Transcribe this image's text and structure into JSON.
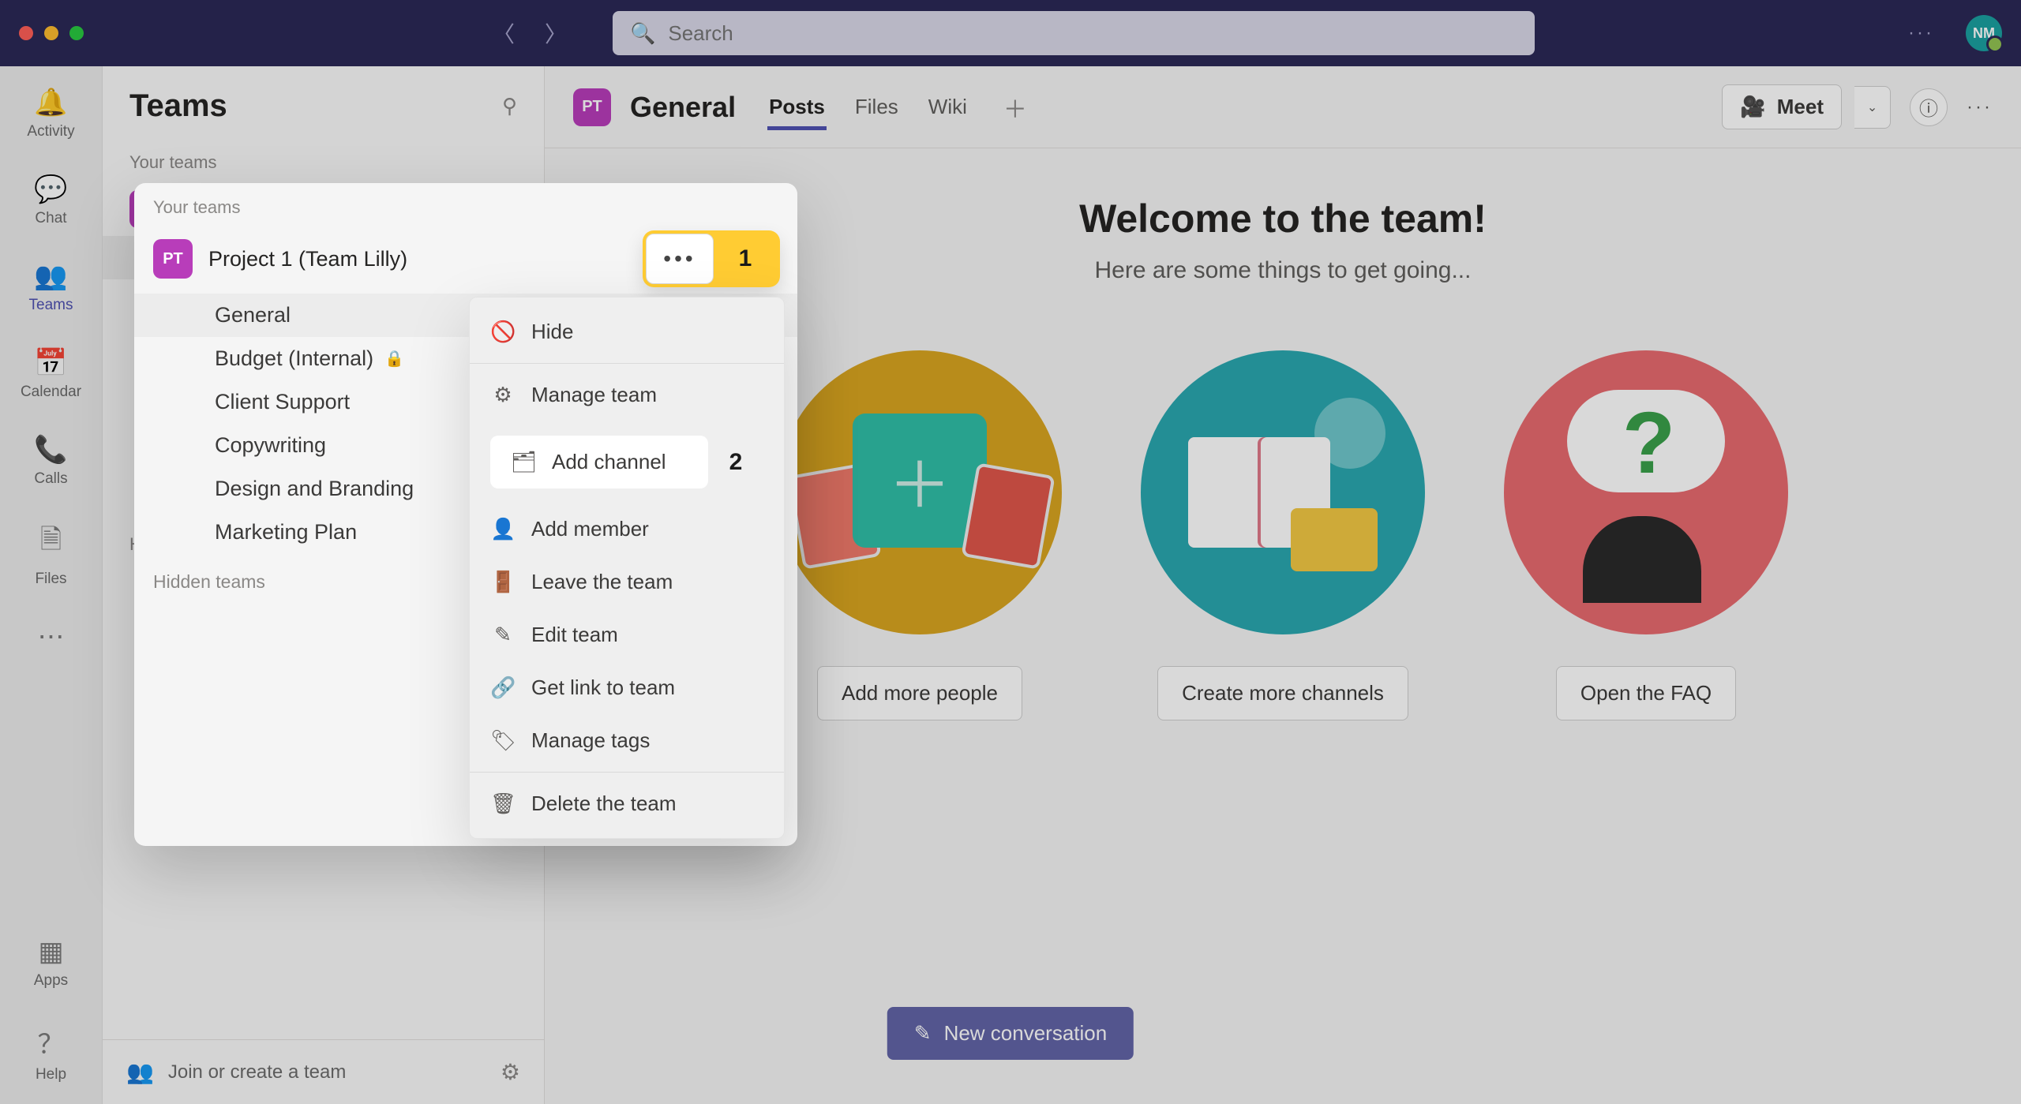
{
  "titlebar": {
    "search_placeholder": "Search",
    "avatar_initials": "NM"
  },
  "rail": {
    "activity": "Activity",
    "chat": "Chat",
    "teams": "Teams",
    "calendar": "Calendar",
    "calls": "Calls",
    "files": "Files",
    "apps": "Apps",
    "help": "Help"
  },
  "sidebar": {
    "title": "Teams",
    "section_your_teams": "Your teams",
    "team_badge": "PT",
    "team_name": "Project 1 (Team Lilly)",
    "channels": {
      "general": "General",
      "budget": "Budget (Internal)",
      "client": "Client Support",
      "copy": "Copywriting",
      "design": "Design and Branding",
      "marketing": "Marketing Plan"
    },
    "section_hidden": "Hidden teams",
    "join_or_create": "Join or create a team"
  },
  "header": {
    "badge": "PT",
    "title": "General",
    "tabs": {
      "posts": "Posts",
      "files": "Files",
      "wiki": "Wiki"
    },
    "meet": "Meet"
  },
  "welcome": {
    "title": "Welcome to the team!",
    "subtitle": "Here are some things to get going...",
    "btn_people": "Add more people",
    "btn_channels": "Create more channels",
    "btn_faq": "Open the FAQ"
  },
  "compose": {
    "label": "New conversation"
  },
  "context_menu": {
    "hide": "Hide",
    "manage_team": "Manage team",
    "add_channel": "Add channel",
    "add_member": "Add member",
    "leave_team": "Leave the team",
    "edit_team": "Edit team",
    "get_link": "Get link to team",
    "manage_tags": "Manage tags",
    "delete_team": "Delete the team"
  },
  "callouts": {
    "one": "1",
    "two": "2"
  }
}
